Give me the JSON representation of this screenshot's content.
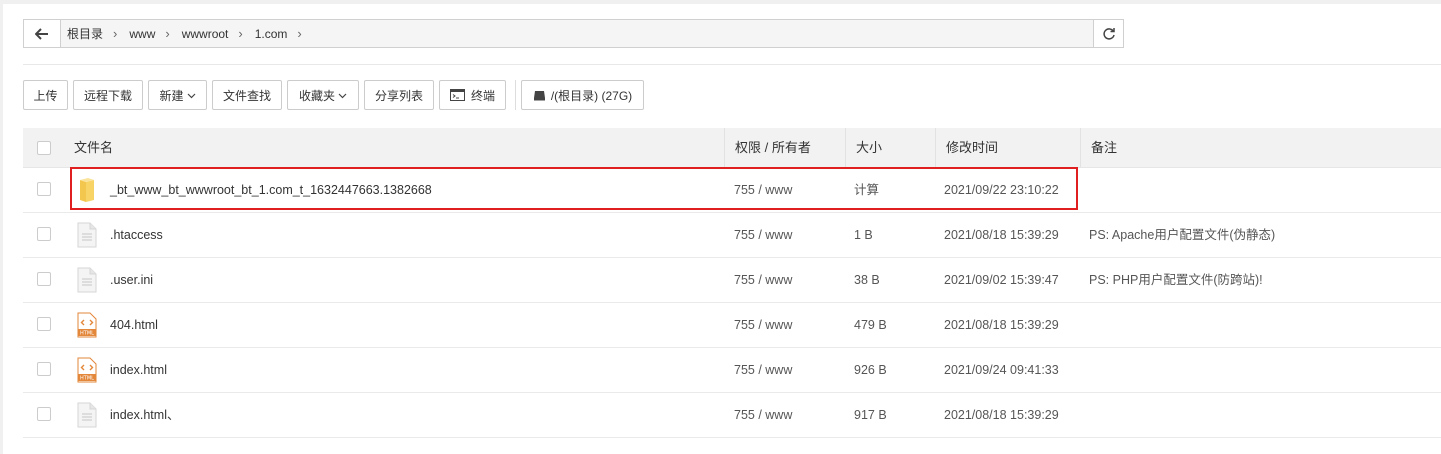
{
  "breadcrumb": [
    "根目录",
    "www",
    "wwwroot",
    "1.com"
  ],
  "toolbar": {
    "upload": "上传",
    "remote_download": "远程下载",
    "new": "新建",
    "file_search": "文件查找",
    "favorites": "收藏夹",
    "share_list": "分享列表",
    "terminal": "终端",
    "disk": "/(根目录) (27G)"
  },
  "table": {
    "headers": {
      "name": "文件名",
      "perm": "权限 / 所有者",
      "size": "大小",
      "mtime": "修改时间",
      "remark": "备注"
    },
    "rows": [
      {
        "icon": "folder-icon",
        "name": "_bt_www_bt_wwwroot_bt_1.com_t_1632447663.1382668",
        "perm": "755 / www",
        "size": "计算",
        "mtime": "2021/09/22 23:10:22",
        "remark": ""
      },
      {
        "icon": "file-icon",
        "name": ".htaccess",
        "perm": "755 / www",
        "size": "1 B",
        "mtime": "2021/08/18 15:39:29",
        "remark": "PS: Apache用户配置文件(伪静态)"
      },
      {
        "icon": "file-icon",
        "name": ".user.ini",
        "perm": "755 / www",
        "size": "38 B",
        "mtime": "2021/09/02 15:39:47",
        "remark": "PS: PHP用户配置文件(防跨站)!"
      },
      {
        "icon": "html-file-icon",
        "name": "404.html",
        "perm": "755 / www",
        "size": "479 B",
        "mtime": "2021/08/18 15:39:29",
        "remark": ""
      },
      {
        "icon": "html-file-icon",
        "name": "index.html",
        "perm": "755 / www",
        "size": "926 B",
        "mtime": "2021/09/24 09:41:33",
        "remark": ""
      },
      {
        "icon": "file-icon",
        "name": "index.html、",
        "perm": "755 / www",
        "size": "917 B",
        "mtime": "2021/08/18 15:39:29",
        "remark": ""
      }
    ]
  },
  "colors": {
    "accent_green": "#20a53a",
    "highlight_red": "#e02020"
  }
}
